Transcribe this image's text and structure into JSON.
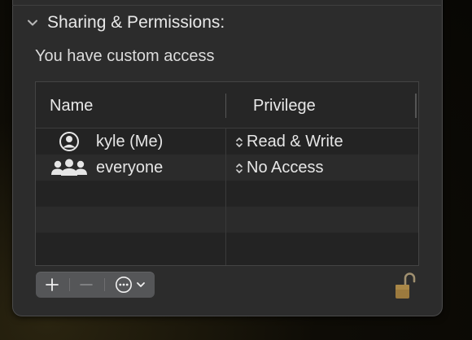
{
  "section": {
    "title": "Sharing & Permissions:",
    "access_text": "You have custom access"
  },
  "table": {
    "columns": {
      "name": "Name",
      "privilege": "Privilege"
    },
    "rows": [
      {
        "icon": "user-circle-icon",
        "name": "kyle (Me)",
        "privilege": "Read & Write"
      },
      {
        "icon": "group-icon",
        "name": "everyone",
        "privilege": "No Access"
      }
    ]
  },
  "toolbar": {
    "add_label": "+",
    "remove_label": "−"
  },
  "icons": {
    "chevron": "chevron-down-icon",
    "action": "ellipsis-circle-icon",
    "lock": "lock-unlocked-icon"
  },
  "colors": {
    "panel_bg": "#2c2c2c",
    "button_bg": "#555658",
    "lock_color": "#a8884a"
  }
}
